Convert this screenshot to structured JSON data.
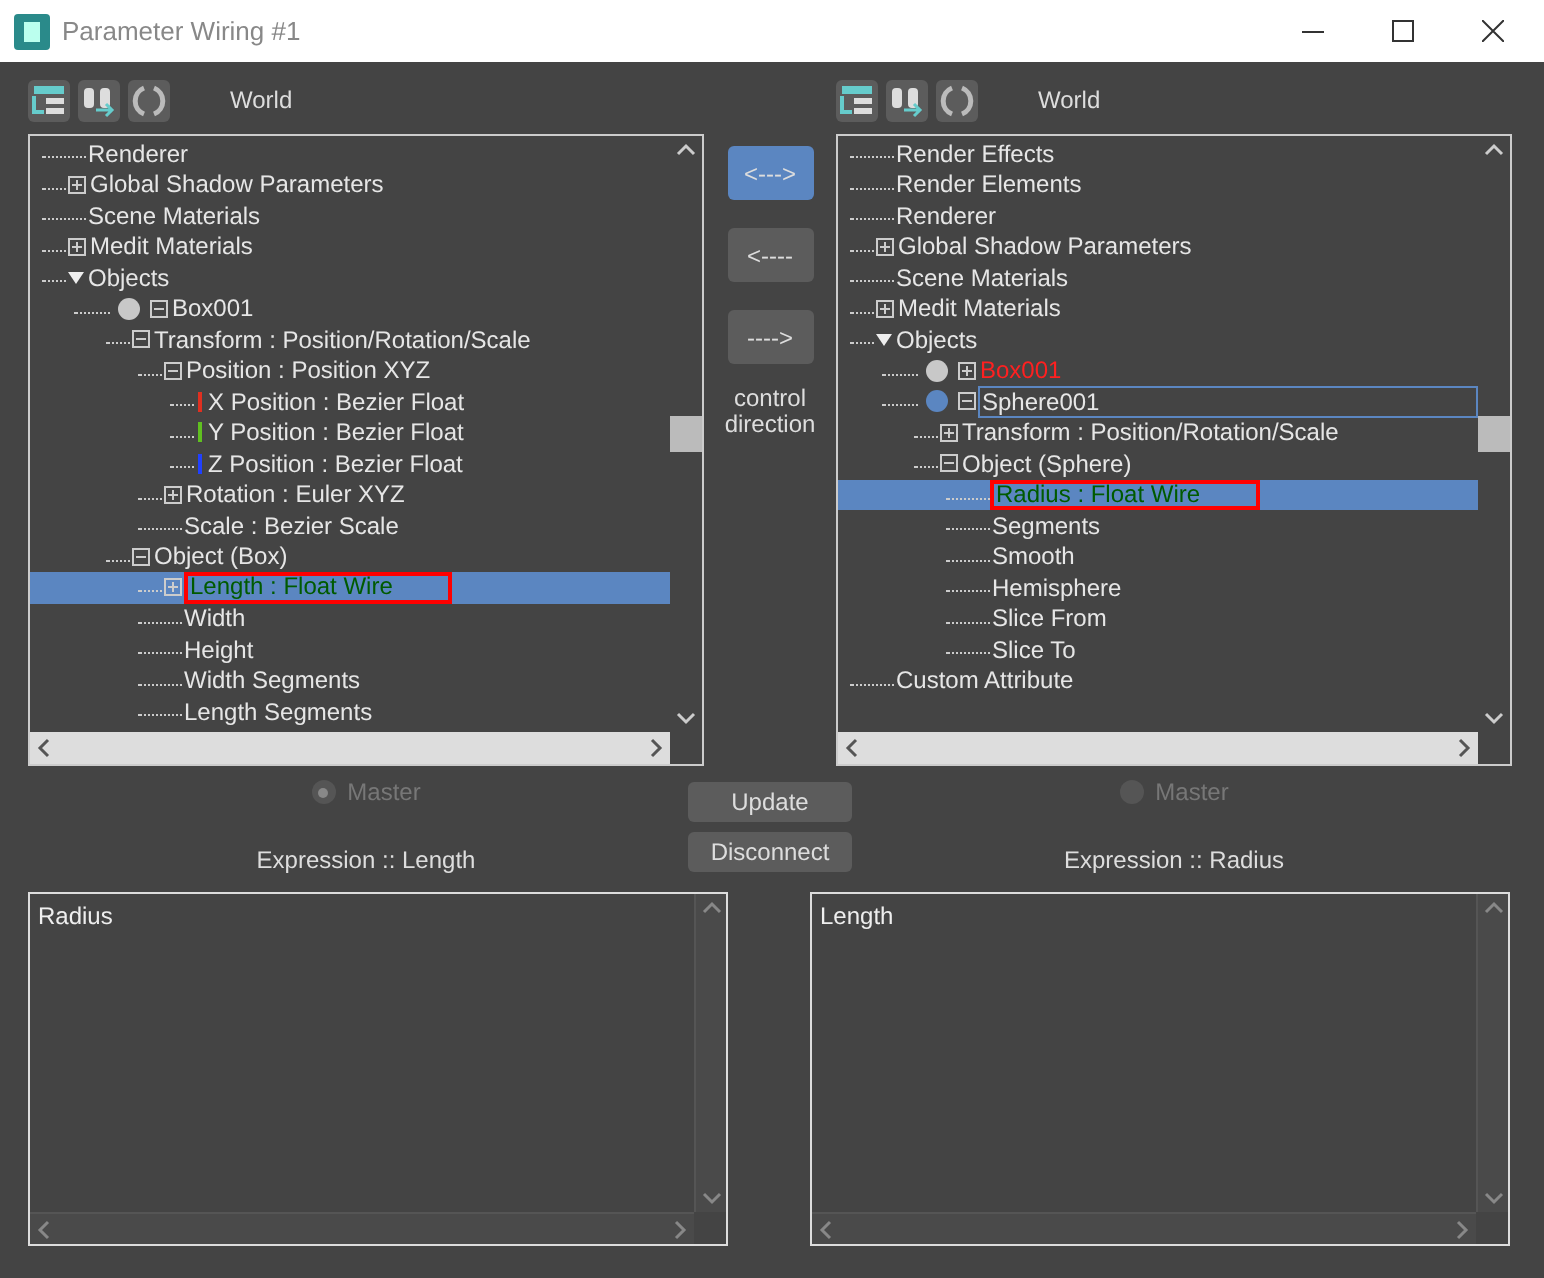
{
  "window": {
    "title": "Parameter Wiring #1"
  },
  "panels": [
    {
      "space": "World",
      "master": {
        "label": "Master",
        "selected": true
      },
      "expression_label": "Expression :: Length",
      "expression": "Radius",
      "tree": [
        {
          "label": "Renderer"
        },
        {
          "label": "Global Shadow Parameters",
          "expanded": false
        },
        {
          "label": "Scene Materials"
        },
        {
          "label": "Medit Materials",
          "expanded": false
        },
        {
          "label": "Objects",
          "kind": "group",
          "expanded": true,
          "children": [
            {
              "label": "Box001",
              "kind": "object",
              "color": "#c8c8c8",
              "expanded": true,
              "children": [
                {
                  "label": "Transform : Position/Rotation/Scale",
                  "expanded": true,
                  "children": [
                    {
                      "label": "Position : Position XYZ",
                      "expanded": true,
                      "children": [
                        {
                          "label": "X Position : Bezier Float",
                          "kind": "axis",
                          "color": "#e03020"
                        },
                        {
                          "label": "Y Position : Bezier Float",
                          "kind": "axis",
                          "color": "#60c020"
                        },
                        {
                          "label": "Z Position : Bezier Float",
                          "kind": "axis",
                          "color": "#2040ff"
                        }
                      ]
                    },
                    {
                      "label": "Rotation : Euler XYZ",
                      "expanded": false
                    },
                    {
                      "label": "Scale : Bezier Scale"
                    }
                  ]
                },
                {
                  "label": "Object (Box)",
                  "expanded": true,
                  "children": [
                    {
                      "label": "Length : Float Wire",
                      "expanded": false,
                      "wired": true,
                      "selected": true,
                      "annotated": true
                    },
                    {
                      "label": "Width"
                    },
                    {
                      "label": "Height"
                    },
                    {
                      "label": "Width Segments"
                    },
                    {
                      "label": "Length Segments"
                    }
                  ]
                }
              ]
            }
          ]
        }
      ]
    },
    {
      "space": "World",
      "master": {
        "label": "Master",
        "selected": false
      },
      "expression_label": "Expression :: Radius",
      "expression": "Length",
      "tree": [
        {
          "label": "Render Effects"
        },
        {
          "label": "Render Elements"
        },
        {
          "label": "Renderer"
        },
        {
          "label": "Global Shadow Parameters",
          "expanded": false
        },
        {
          "label": "Scene Materials"
        },
        {
          "label": "Medit Materials",
          "expanded": false
        },
        {
          "label": "Objects",
          "kind": "group",
          "expanded": true,
          "children": [
            {
              "label": "Box001",
              "kind": "object",
              "color": "#c8c8c8",
              "expanded": false,
              "flagged": true
            },
            {
              "label": "Sphere001",
              "kind": "object",
              "color": "#5b86c1",
              "expanded": true,
              "focused": true,
              "children": [
                {
                  "label": "Transform : Position/Rotation/Scale",
                  "expanded": false
                },
                {
                  "label": "Object (Sphere)",
                  "expanded": true,
                  "children": [
                    {
                      "label": "Radius : Float Wire",
                      "wired": true,
                      "selected": true,
                      "annotated": true
                    },
                    {
                      "label": "Segments"
                    },
                    {
                      "label": "Smooth"
                    },
                    {
                      "label": "Hemisphere"
                    },
                    {
                      "label": "Slice From"
                    },
                    {
                      "label": "Slice To"
                    }
                  ]
                }
              ]
            }
          ]
        },
        {
          "label": "Custom Attribute"
        }
      ]
    }
  ],
  "direction_buttons": [
    {
      "label": "<--->",
      "selected": true
    },
    {
      "label": "<----",
      "selected": false
    },
    {
      "label": "---->",
      "selected": false
    }
  ],
  "direction_caption": "control direction",
  "actions": [
    "Update",
    "Disconnect"
  ]
}
